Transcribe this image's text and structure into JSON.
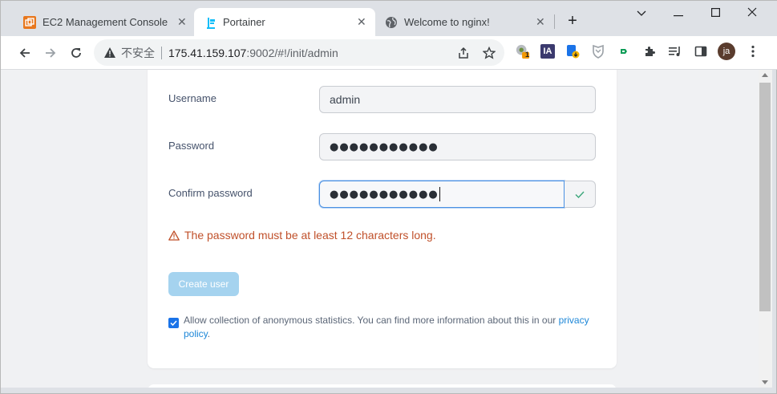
{
  "browser": {
    "tabs": [
      {
        "title": "EC2 Management Console",
        "icon": "aws-icon",
        "active": false
      },
      {
        "title": "Portainer",
        "icon": "portainer-icon",
        "active": true
      },
      {
        "title": "Welcome to nginx!",
        "icon": "globe-icon",
        "active": false
      }
    ],
    "new_tab": "+",
    "window_controls": {
      "dropdown": "⌄",
      "minimize": "—",
      "maximize": "☐",
      "close": "✕"
    },
    "address": {
      "security_label": "不安全",
      "url_host": "175.41.159.107",
      "url_rest": ":9002/#!/init/admin"
    },
    "extensions": [
      {
        "name": "chrome-ext-badge-icon",
        "badge": "1"
      },
      {
        "name": "ia-ext-icon",
        "label": "IA"
      },
      {
        "name": "translate-ext-icon"
      },
      {
        "name": "shield-ext-icon"
      },
      {
        "name": "green-ext-icon"
      },
      {
        "name": "puzzle-icon"
      },
      {
        "name": "media-icon"
      },
      {
        "name": "sidepanel-icon"
      }
    ],
    "profile": "ja",
    "colors": {
      "accent": "#1a73e8"
    }
  },
  "form": {
    "username": {
      "label": "Username",
      "value": "admin"
    },
    "password": {
      "label": "Password",
      "value": "●●●●●●●●●●●"
    },
    "confirm": {
      "label": "Confirm password",
      "value": "●●●●●●●●●●●"
    },
    "error": "The password must be at least 12 characters long.",
    "create_button": "Create user",
    "stats": {
      "text": "Allow collection of anonymous statistics. You can find more information about this in our ",
      "link": "privacy policy",
      "suffix": ".",
      "checked": true
    }
  }
}
